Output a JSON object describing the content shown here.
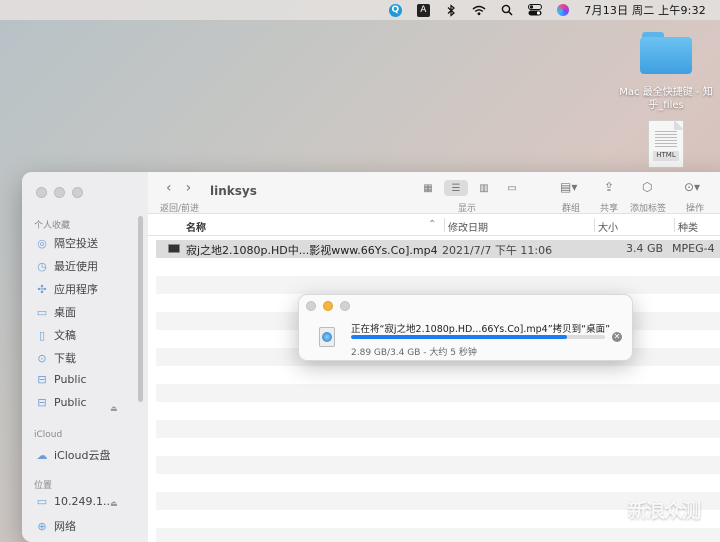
{
  "menubar": {
    "clock": "7月13日 周二 上午9:32"
  },
  "desktop": {
    "folder_label": "Mac 最全快捷键 - 知乎_files",
    "html_file_tag": "HTML"
  },
  "finder": {
    "title": "linksys",
    "nav_label": "返回/前进",
    "toolbar": {
      "view_label": "显示",
      "group_label": "群组",
      "share_label": "共享",
      "tag_label": "添加标签",
      "action_label": "操作"
    },
    "sidebar": {
      "favorites_heading": "个人收藏",
      "favorites": [
        {
          "label": "隔空投送",
          "icon": "airdrop-icon"
        },
        {
          "label": "最近使用",
          "icon": "clock-icon"
        },
        {
          "label": "应用程序",
          "icon": "apps-icon"
        },
        {
          "label": "桌面",
          "icon": "desktop-icon"
        },
        {
          "label": "文稿",
          "icon": "document-icon"
        },
        {
          "label": "下载",
          "icon": "download-icon"
        },
        {
          "label": "Public",
          "icon": "network-drive-icon"
        },
        {
          "label": "Public",
          "icon": "network-drive-icon"
        }
      ],
      "icloud_heading": "iCloud",
      "icloud_item": "iCloud云盘",
      "locations_heading": "位置",
      "location_item": "10.249.1...",
      "network_item": "网络"
    },
    "columns": {
      "name": "名称",
      "date": "修改日期",
      "size": "大小",
      "kind": "种类"
    },
    "file": {
      "name": "寂j之地2.1080p.HD中...影视www.66Ys.Co].mp4",
      "date": "2021/7/7 下午 11:06",
      "size": "3.4 GB",
      "kind": "MPEG-4"
    }
  },
  "copy_dialog": {
    "message": "正在将“寂j之地2.1080p.HD...66Ys.Co].mp4”拷贝到“桌面”",
    "status": "2.89 GB/3.4 GB - 大约 5 秒钟",
    "progress": 0.85
  },
  "watermark": "新浪众测",
  "colors": {
    "accent": "#1e7cf2",
    "minimize": "#f6b43c"
  }
}
